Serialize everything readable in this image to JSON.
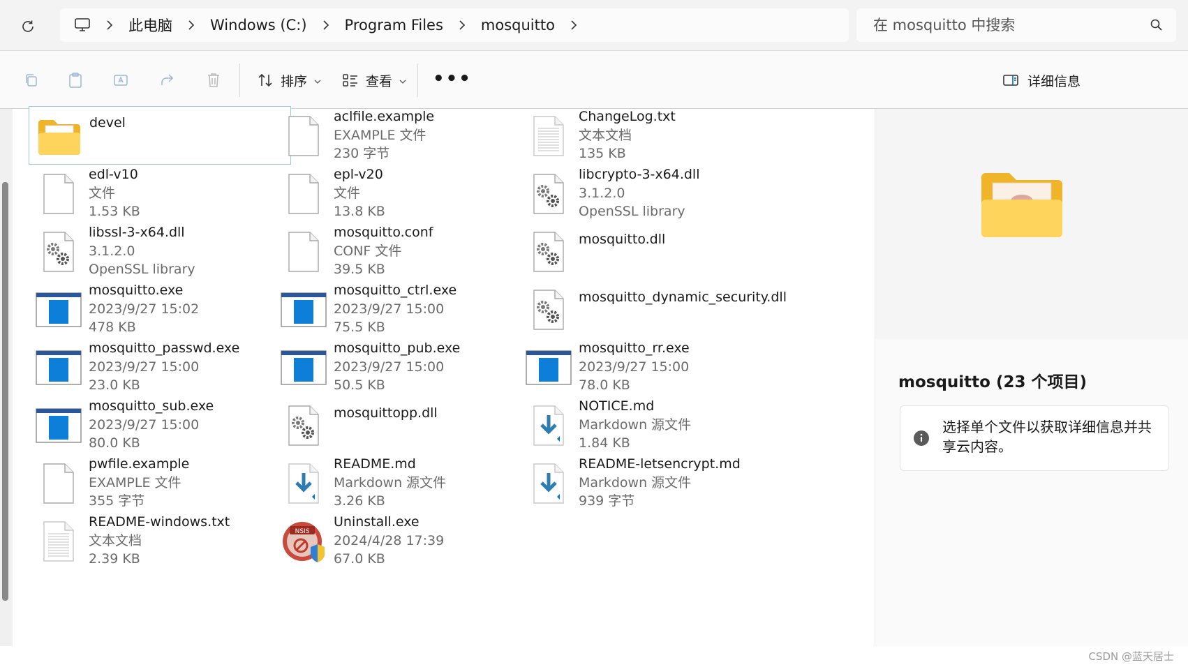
{
  "address_bar": {
    "crumbs": [
      "此电脑",
      "Windows (C:)",
      "Program Files",
      "mosquitto"
    ],
    "search_placeholder": "在 mosquitto 中搜索"
  },
  "toolbar": {
    "sort_label": "排序",
    "view_label": "查看",
    "more_label": "•••",
    "details_label": "详细信息"
  },
  "items": [
    {
      "name": "devel",
      "line2": "",
      "line3": "",
      "icon": "folder-icon"
    },
    {
      "name": "aclfile.example",
      "line2": "EXAMPLE 文件",
      "line3": "230 字节",
      "icon": "generic-file-icon"
    },
    {
      "name": "ChangeLog.txt",
      "line2": "文本文档",
      "line3": "135 KB",
      "icon": "text-file-icon"
    },
    {
      "name": "edl-v10",
      "line2": "文件",
      "line3": "1.53 KB",
      "icon": "generic-file-icon"
    },
    {
      "name": "epl-v20",
      "line2": "文件",
      "line3": "13.8 KB",
      "icon": "generic-file-icon"
    },
    {
      "name": "libcrypto-3-x64.dll",
      "line2": "3.1.2.0",
      "line3": "OpenSSL library",
      "icon": "dll-file-icon"
    },
    {
      "name": "libssl-3-x64.dll",
      "line2": "3.1.2.0",
      "line3": "OpenSSL library",
      "icon": "dll-file-icon"
    },
    {
      "name": "mosquitto.conf",
      "line2": "CONF 文件",
      "line3": "39.5 KB",
      "icon": "generic-file-icon"
    },
    {
      "name": "mosquitto.dll",
      "line2": "",
      "line3": "",
      "icon": "dll-file-icon"
    },
    {
      "name": "mosquitto.exe",
      "line2": "2023/9/27 15:02",
      "line3": "478 KB",
      "icon": "exe-file-icon"
    },
    {
      "name": "mosquitto_ctrl.exe",
      "line2": "2023/9/27 15:00",
      "line3": "75.5 KB",
      "icon": "exe-file-icon"
    },
    {
      "name": "mosquitto_dynamic_security.dll",
      "line2": "",
      "line3": "",
      "icon": "dll-file-icon"
    },
    {
      "name": "mosquitto_passwd.exe",
      "line2": "2023/9/27 15:00",
      "line3": "23.0 KB",
      "icon": "exe-file-icon"
    },
    {
      "name": "mosquitto_pub.exe",
      "line2": "2023/9/27 15:00",
      "line3": "50.5 KB",
      "icon": "exe-file-icon"
    },
    {
      "name": "mosquitto_rr.exe",
      "line2": "2023/9/27 15:00",
      "line3": "78.0 KB",
      "icon": "exe-file-icon"
    },
    {
      "name": "mosquitto_sub.exe",
      "line2": "2023/9/27 15:00",
      "line3": "80.0 KB",
      "icon": "exe-file-icon"
    },
    {
      "name": "mosquittopp.dll",
      "line2": "",
      "line3": "",
      "icon": "dll-file-icon"
    },
    {
      "name": "NOTICE.md",
      "line2": "Markdown 源文件",
      "line3": "1.84 KB",
      "icon": "markdown-file-icon"
    },
    {
      "name": "pwfile.example",
      "line2": "EXAMPLE 文件",
      "line3": "355 字节",
      "icon": "generic-file-icon"
    },
    {
      "name": "README.md",
      "line2": "Markdown 源文件",
      "line3": "3.26 KB",
      "icon": "markdown-file-icon"
    },
    {
      "name": "README-letsencrypt.md",
      "line2": "Markdown 源文件",
      "line3": "939 字节",
      "icon": "markdown-file-icon"
    },
    {
      "name": "README-windows.txt",
      "line2": "文本文档",
      "line3": "2.39 KB",
      "icon": "text-file-icon"
    },
    {
      "name": "Uninstall.exe",
      "line2": "2024/4/28 17:39",
      "line3": "67.0 KB",
      "icon": "nsis-installer-icon"
    }
  ],
  "details_pane": {
    "title": "mosquitto (23 个项目)",
    "info_message": "选择单个文件以获取详细信息并共享云内容。"
  },
  "watermark": "CSDN @蓝天居士"
}
